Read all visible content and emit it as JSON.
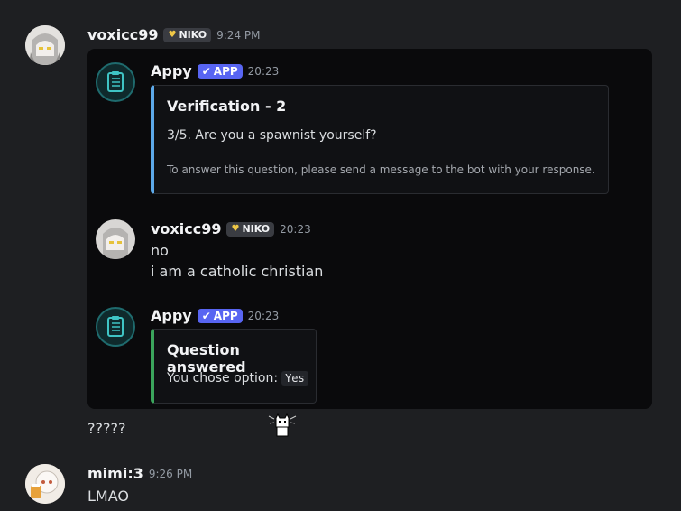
{
  "messages": {
    "m1": {
      "username": "voxicc99",
      "badge": "NIKO",
      "time": "9:24 PM"
    },
    "bot1": {
      "name": "Appy",
      "app_badge": "APP",
      "time": "20:23",
      "embed": {
        "title": "Verification - 2",
        "description": "3/5. Are you a spawnist yourself?",
        "footer": "To answer this question, please send a message to the bot with your response."
      }
    },
    "inner_user": {
      "username": "voxicc99",
      "badge": "NIKO",
      "time": "20:23",
      "line1": "no",
      "line2": "i am a catholic christian"
    },
    "bot2": {
      "name": "Appy",
      "app_badge": "APP",
      "time": "20:23",
      "embed": {
        "title": "Question answered",
        "description": "You chose option:",
        "code": "Yes"
      }
    },
    "m1_text": "?????",
    "m2": {
      "username": "mimi:3",
      "time": "9:26 PM",
      "text": "LMAO"
    }
  },
  "colors": {
    "background": "#1e1f22",
    "app_badge": "#5865f2",
    "embed_accent_blue": "#5da9e9",
    "embed_accent_green": "#3ba55c",
    "heart": "#f0c846"
  },
  "icons": [
    "heart-icon",
    "checkmark-icon",
    "clipboard-icon",
    "cat-sticker-icon"
  ]
}
